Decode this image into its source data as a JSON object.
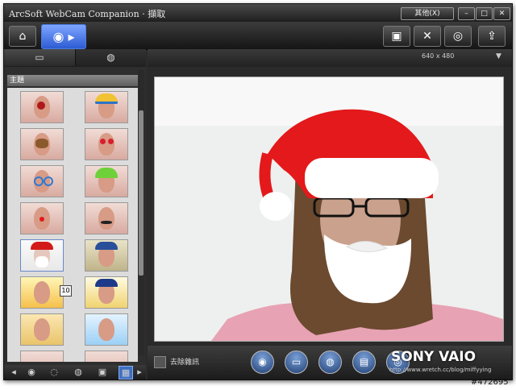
{
  "window": {
    "title": "ArcSoft WebCam Companion · 擷取",
    "other_label": "其他(X)",
    "minimize_icon": "–",
    "maximize_icon": "□",
    "close_icon": "✕"
  },
  "toolbar": {
    "home_icon": "⌂",
    "camera_icon": "◉ ▸",
    "settings_icons": [
      "▣",
      "✕",
      "◎",
      "⇪"
    ]
  },
  "sidebar": {
    "tab_a_icon": "▭",
    "tab_b_icon": "◍",
    "section_title": "主題",
    "selected_badge": "10",
    "bottom_icons": [
      "◂",
      "◉",
      "◌",
      "◍",
      "▣",
      "▦",
      "▸"
    ]
  },
  "main": {
    "resolution": "640 x 480",
    "resolution_arrow": "▼",
    "noise_label": "去除雜訊"
  },
  "bottom": {
    "buttons": [
      "◉",
      "▭",
      "◍",
      "▤",
      "◎"
    ]
  },
  "watermark": {
    "brand": "SONY VAIO",
    "url": "http://www.wretch.cc/blog/miffyying"
  },
  "stock_id": "#472695",
  "colors": {
    "accent_blue": "#2d5bd4",
    "santa_red": "#e3191b",
    "beard_white": "#ffffff"
  }
}
